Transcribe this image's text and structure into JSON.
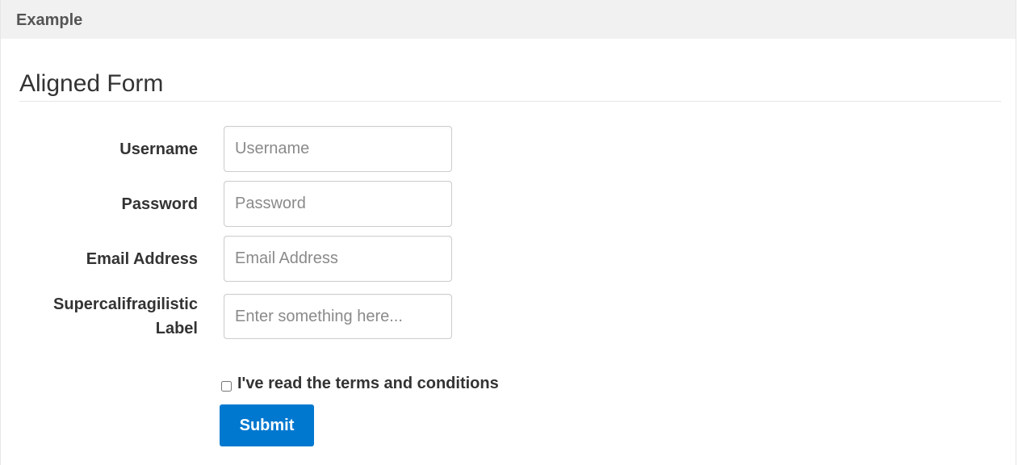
{
  "header": {
    "title": "Example"
  },
  "form": {
    "legend": "Aligned Form",
    "fields": [
      {
        "label": "Username",
        "placeholder": "Username",
        "value": ""
      },
      {
        "label": "Password",
        "placeholder": "Password",
        "value": ""
      },
      {
        "label": "Email Address",
        "placeholder": "Email Address",
        "value": ""
      },
      {
        "label_line1": "Supercalifragilistic",
        "label_line2": "Label",
        "placeholder": "Enter something here...",
        "value": ""
      }
    ],
    "checkbox": {
      "label": "I've read the terms and conditions",
      "checked": false
    },
    "submit_label": "Submit"
  },
  "colors": {
    "accent": "#0078d0",
    "header_bg": "#f1f1f1",
    "text": "#333333"
  }
}
